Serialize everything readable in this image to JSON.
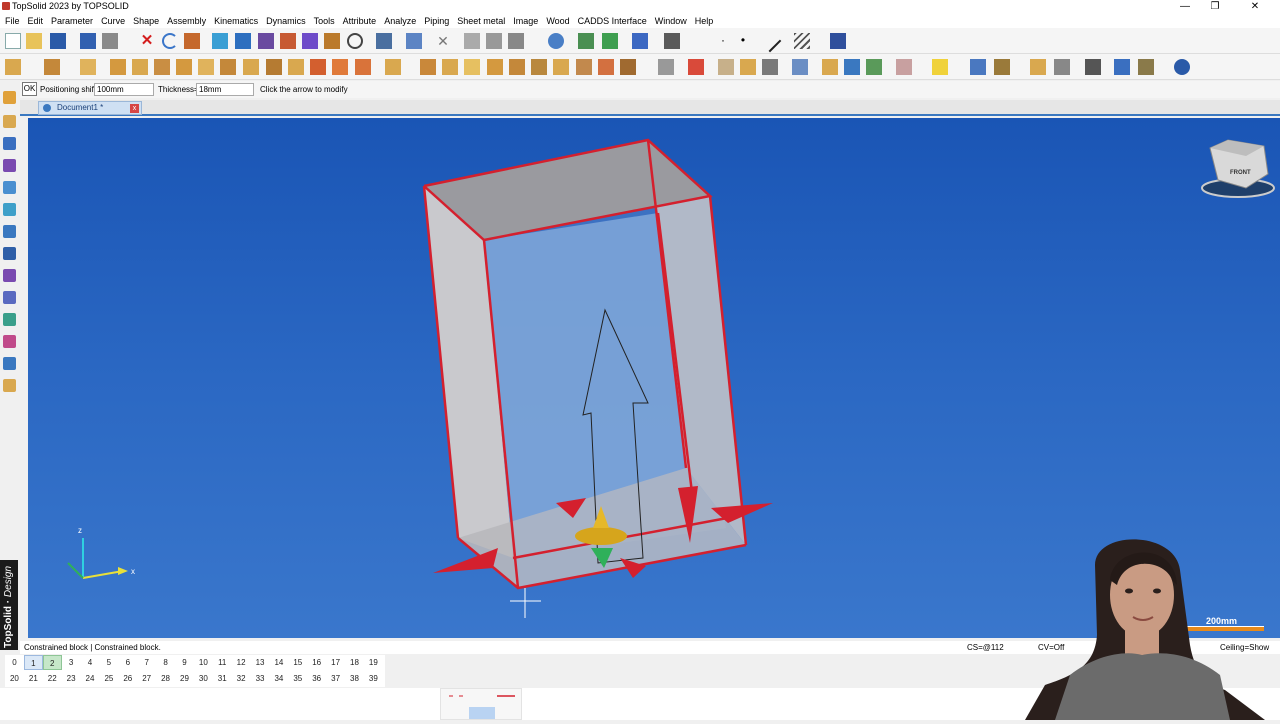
{
  "window": {
    "title": "TopSolid 2023 by TOPSOLID"
  },
  "menu": [
    "File",
    "Edit",
    "Parameter",
    "Curve",
    "Shape",
    "Assembly",
    "Kinematics",
    "Dynamics",
    "Tools",
    "Attribute",
    "Analyze",
    "Piping",
    "Sheet metal",
    "Image",
    "Wood",
    "CADDS Interface",
    "Window",
    "Help"
  ],
  "command_bar": {
    "ok_label": "OK",
    "positioning_shift_label": "Positioning shift=",
    "positioning_shift_value": "100mm",
    "thickness_label": "Thickness=",
    "thickness_value": "18mm",
    "hint": "Click the arrow to modify"
  },
  "document_tab": {
    "name": "Document1 *",
    "close": "x"
  },
  "viewport": {
    "axis_labels": {
      "x": "x",
      "z": "z"
    },
    "view_cube_label": "FRONT",
    "scale_label": "200mm"
  },
  "status": {
    "message": "Constrained block | Constrained block.",
    "cs": "CS=@112",
    "cv": "CV=Off",
    "ceiling": "Ceiling=Show"
  },
  "layers": {
    "row1": [
      "0",
      "1",
      "2",
      "3",
      "4",
      "5",
      "6",
      "7",
      "8",
      "9",
      "10",
      "11",
      "12",
      "13",
      "14",
      "15",
      "16",
      "17",
      "18",
      "19"
    ],
    "row2": [
      "20",
      "21",
      "22",
      "23",
      "24",
      "25",
      "26",
      "27",
      "28",
      "29",
      "30",
      "31",
      "32",
      "33",
      "34",
      "35",
      "36",
      "37",
      "38",
      "39"
    ]
  },
  "branding": {
    "name": "TopSolid",
    "suffix": "Design"
  },
  "colors": {
    "accent": "#d4202e",
    "viewport_top": "#1a55b5",
    "viewport_bottom": "#3a77cc"
  }
}
